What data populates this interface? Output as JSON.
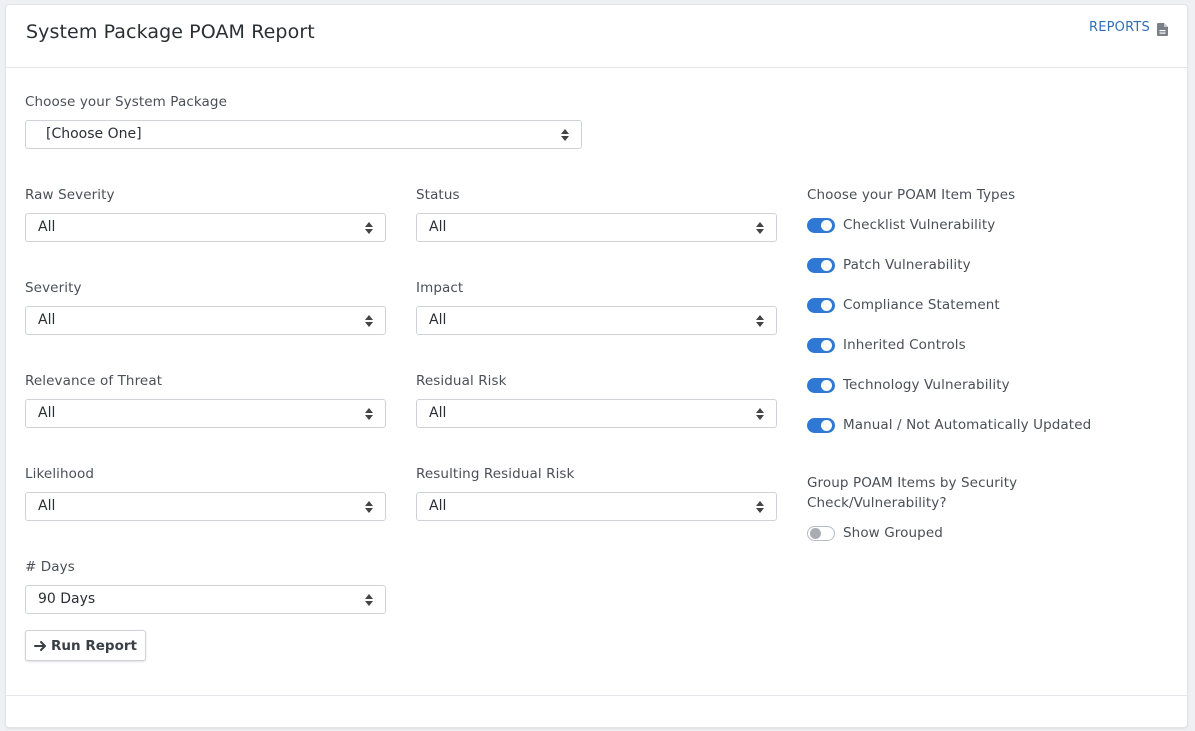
{
  "header": {
    "title": "System Package POAM Report",
    "reports_label": "REPORTS"
  },
  "system_package": {
    "label": "Choose your System Package",
    "value": "[Choose One]"
  },
  "filters": {
    "raw_severity": {
      "label": "Raw Severity",
      "value": "All"
    },
    "status": {
      "label": "Status",
      "value": "All"
    },
    "severity": {
      "label": "Severity",
      "value": "All"
    },
    "impact": {
      "label": "Impact",
      "value": "All"
    },
    "relevance_of_threat": {
      "label": "Relevance of Threat",
      "value": "All"
    },
    "residual_risk": {
      "label": "Residual Risk",
      "value": "All"
    },
    "likelihood": {
      "label": "Likelihood",
      "value": "All"
    },
    "resulting_residual_risk": {
      "label": "Resulting Residual Risk",
      "value": "All"
    },
    "days": {
      "label": "# Days",
      "value": "90 Days"
    }
  },
  "item_types": {
    "heading": "Choose your POAM Item Types",
    "items": [
      {
        "label": "Checklist Vulnerability",
        "checked": true
      },
      {
        "label": "Patch Vulnerability",
        "checked": true
      },
      {
        "label": "Compliance Statement",
        "checked": true
      },
      {
        "label": "Inherited Controls",
        "checked": true
      },
      {
        "label": "Technology Vulnerability",
        "checked": true
      },
      {
        "label": "Manual / Not Automatically Updated",
        "checked": true
      }
    ]
  },
  "grouping": {
    "heading_line1": "Group POAM Items by Security",
    "heading_line2": "Check/Vulnerability?",
    "toggle_label": "Show Grouped",
    "checked": false
  },
  "actions": {
    "run_report_label": "Run Report"
  },
  "colors": {
    "accent": "#2f78d4",
    "link": "#2f6fb8"
  },
  "icons": {
    "reports": "document-icon",
    "run": "arrow-right-icon"
  }
}
